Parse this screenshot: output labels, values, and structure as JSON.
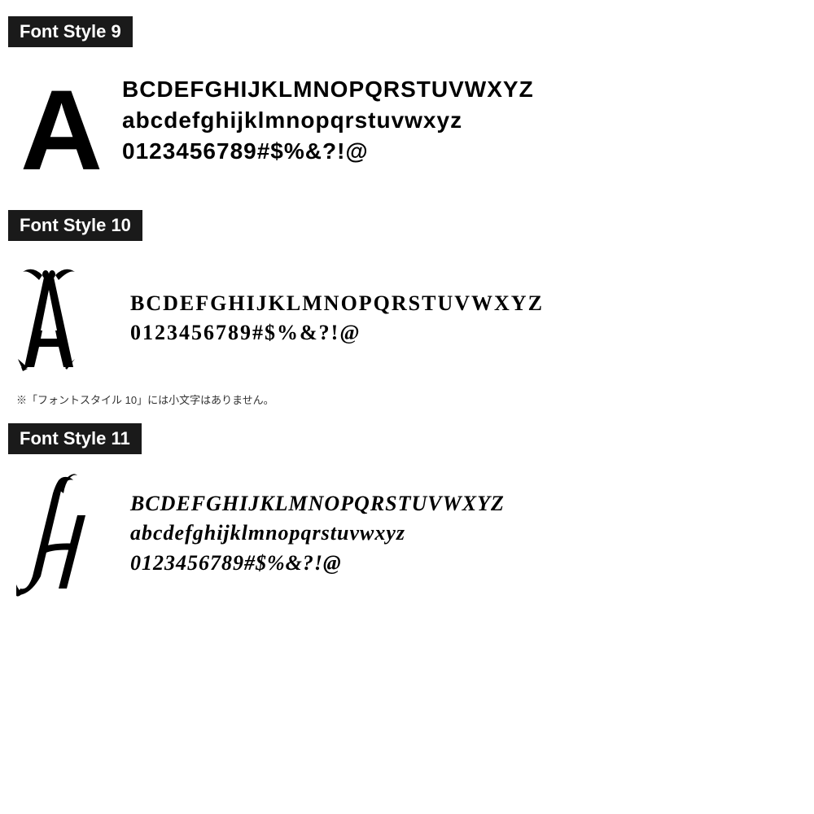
{
  "sections": [
    {
      "id": "font-style-9",
      "label": "Font Style 9",
      "big_letter": "A",
      "lines": [
        "BCDEFGHIJKLMNOPQRSTUVWXYZ",
        "abcdefghijklmnopqrstuvwxyz",
        "0123456789#$%&?!@"
      ],
      "note": null
    },
    {
      "id": "font-style-10",
      "label": "Font Style 10",
      "big_letter": "A",
      "lines": [
        "BCDEFGHIJKLMNOPQRSTUVWXYZ",
        "0123456789#$%&?!@"
      ],
      "note": "※「フォントスタイル 10」には小文字はありません。"
    },
    {
      "id": "font-style-11",
      "label": "Font Style 11",
      "big_letter": "A",
      "lines": [
        "BCDEFGHIJKLMNOPQRSTUVWXYZ",
        "abcdefghijklmnopqrstuvwxyz",
        "0123456789#$%&?!@"
      ],
      "note": null
    }
  ],
  "colors": {
    "label_bg": "#1a1a1a",
    "label_text": "#ffffff",
    "text": "#000000",
    "bg": "#ffffff"
  }
}
